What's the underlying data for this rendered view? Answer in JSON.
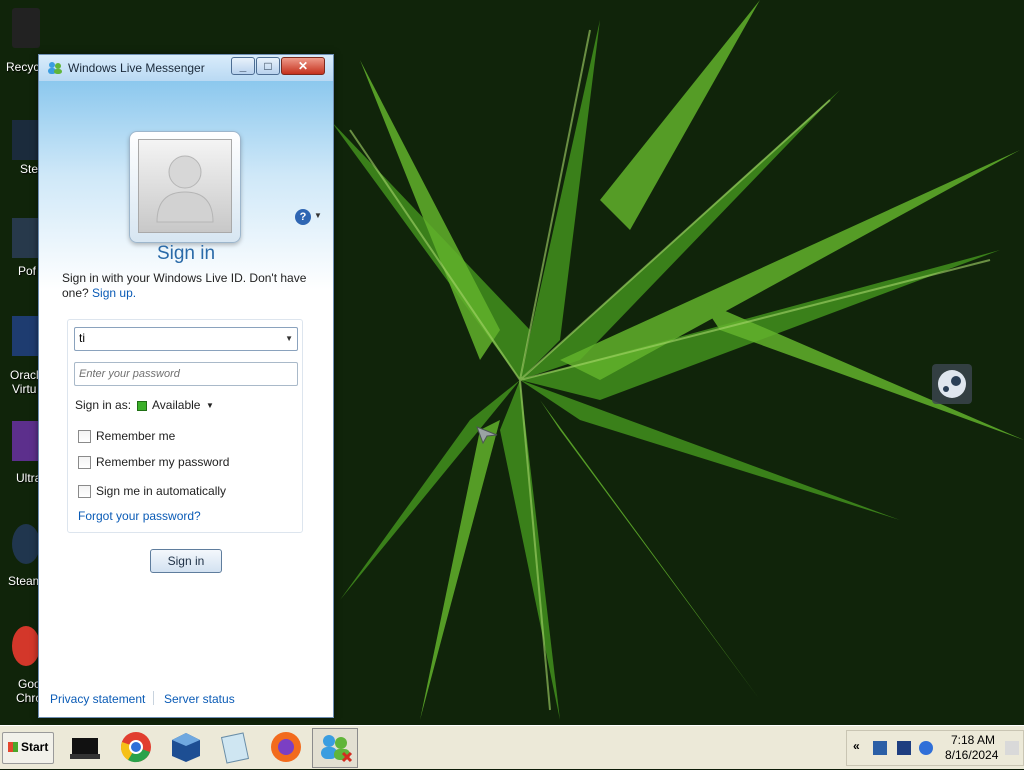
{
  "desktop": {
    "icons": [
      {
        "name": "recycle-bin",
        "label": "Recyc"
      },
      {
        "name": "steam-old",
        "label": "Ste"
      },
      {
        "name": "pof",
        "label": "Pof"
      },
      {
        "name": "oracle-virtualbox",
        "label": "Oracl",
        "label2": "Virtu"
      },
      {
        "name": "ultra",
        "label": "Ultra"
      },
      {
        "name": "steam",
        "label": "Steam"
      },
      {
        "name": "google-chrome",
        "label": "Goo",
        "label2": "Chro"
      }
    ]
  },
  "window": {
    "title": "Windows Live Messenger",
    "controls": {
      "minimize": "_",
      "maximize": "□",
      "close": "✕"
    },
    "help_symbol": "?"
  },
  "signin": {
    "heading": "Sign in",
    "intro_text": "Sign in with your Windows Live ID. Don't have one?",
    "signup_link": "Sign up.",
    "account_value": "ti",
    "password_placeholder": "Enter your password",
    "sign_in_as_label": "Sign in as:",
    "status_value": "Available",
    "remember_me": "Remember me",
    "remember_password": "Remember my password",
    "sign_in_auto": "Sign me in automatically",
    "forgot_password": "Forgot your password?",
    "button": "Sign in",
    "checkboxes": {
      "remember_me": false,
      "remember_password": false,
      "auto": false
    }
  },
  "footer": {
    "privacy": "Privacy statement",
    "server_status": "Server status"
  },
  "taskbar": {
    "start_label": "Start",
    "apps": [
      "terminal-icon",
      "chrome-icon",
      "virtualbox-icon",
      "notepad-icon",
      "firefox-icon",
      "messenger-icon"
    ],
    "tray": {
      "expand": "«"
    },
    "clock": {
      "time": "7:18 AM",
      "date": "8/16/2024"
    }
  },
  "colors": {
    "accent": "#2a6aa8",
    "link": "#0a5bb6",
    "status_available": "#3cb02a"
  }
}
